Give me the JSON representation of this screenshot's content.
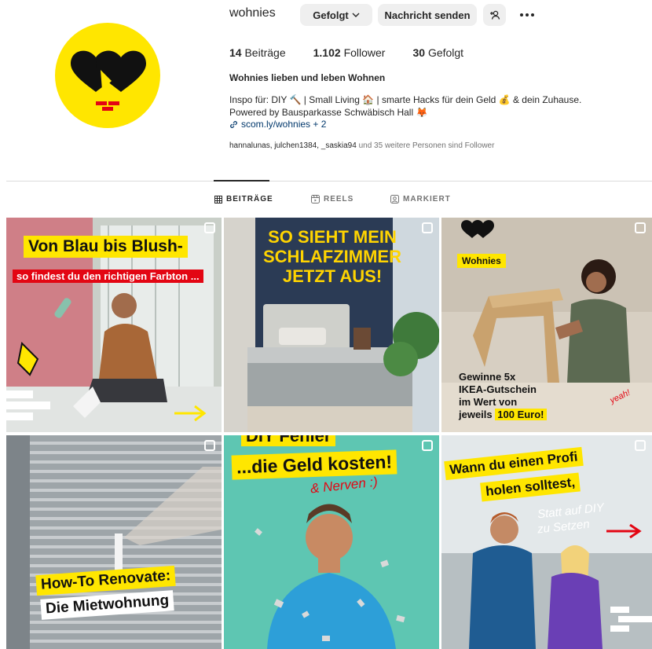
{
  "profile": {
    "username": "wohnies",
    "buttons": {
      "follow": "Gefolgt",
      "message": "Nachricht senden"
    },
    "stats": [
      {
        "count": "14",
        "label": "Beiträge"
      },
      {
        "count": "1.102",
        "label": "Follower"
      },
      {
        "count": "30",
        "label": "Gefolgt"
      }
    ],
    "full_name": "Wohnies lieben und leben Wohnen",
    "bio": [
      "Inspo für: DIY 🔨 | Small Living 🏠 | smarte Hacks für dein Geld 💰 & dein Zuhause.",
      "Powered by Bausparkasse Schwäbisch Hall 🦊"
    ],
    "link": "scom.ly/wohnies + 2",
    "followed_by": {
      "names": "hannalunas, julchen1384, _saskia94",
      "rest": " und 35 weitere Personen sind Follower"
    }
  },
  "tabs": [
    {
      "label": "BEITRÄGE",
      "icon": "grid-icon"
    },
    {
      "label": "REELS",
      "icon": "reels-icon"
    },
    {
      "label": "MARKIERT",
      "icon": "tagged-icon"
    }
  ],
  "posts": [
    {
      "line1": "Von Blau bis Blush-",
      "line2": "so findest du den richtigen Farbton ..."
    },
    {
      "line1": "SO SIEHT MEIN",
      "line2": "SCHLAFZIMMER",
      "line3": "JETZT AUS!"
    },
    {
      "brand": "Wohnies",
      "line1": "Gewinne 5x",
      "line2": "IKEA-Gutschein",
      "line3": "im Wert von",
      "line4": "jeweils",
      "highlight": "100 Euro!",
      "tag": "yeah!"
    },
    {
      "line1": "How-To Renovate:",
      "line2": "Die Mietwohnung"
    },
    {
      "line0": "DIY Fehler",
      "line1": "...die Geld kosten!",
      "line2": "& Nerven :)"
    },
    {
      "line1": "Wann du einen Profi",
      "line2": "holen solltest,",
      "line3": "Statt auf DIY",
      "line4": "zu Setzen"
    }
  ],
  "colors": {
    "brand_yellow": "#ffe600",
    "brand_red": "#e30613",
    "link": "#00376b"
  }
}
